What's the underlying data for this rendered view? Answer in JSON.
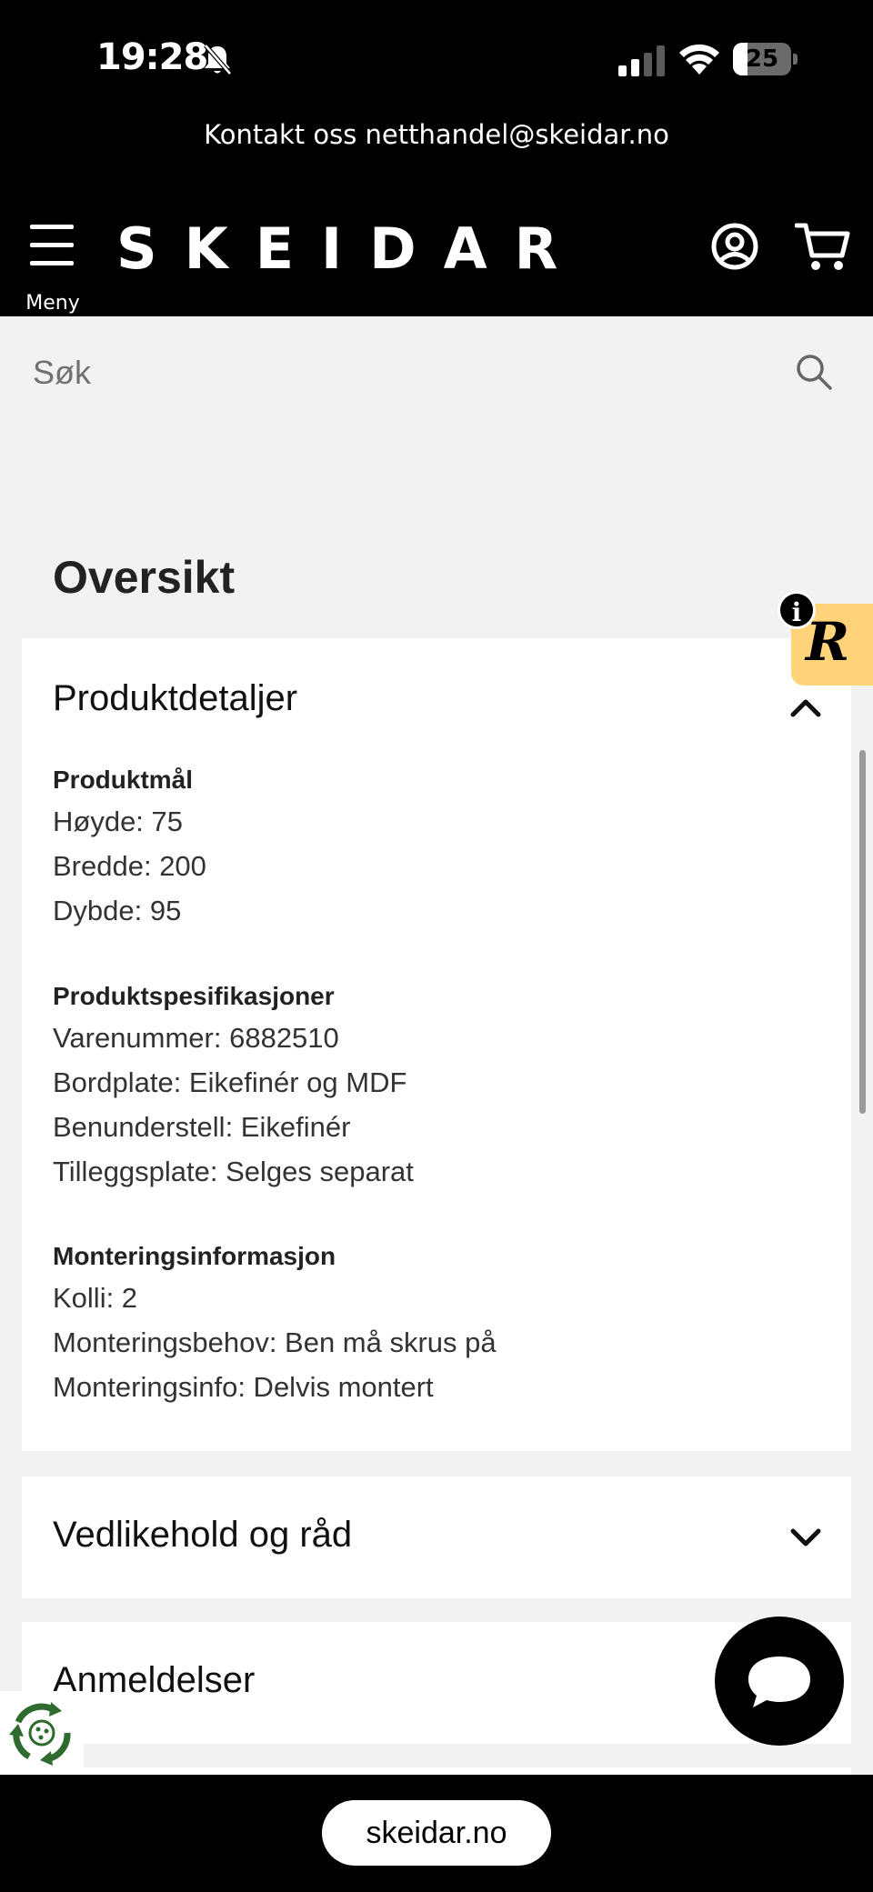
{
  "status_bar": {
    "time": "19:28",
    "battery": "25",
    "battery_level_percent": 25,
    "icons": [
      "bell-slash-icon",
      "signal-icon",
      "wifi-icon",
      "battery-icon"
    ]
  },
  "banner": {
    "contact_text": "Kontakt oss netthandel@skeidar.no"
  },
  "header": {
    "menu_label": "Meny",
    "logo": "SKEIDAR",
    "icons": [
      "menu-icon",
      "account-icon",
      "cart-icon"
    ]
  },
  "search": {
    "placeholder": "Søk"
  },
  "overview": {
    "heading": "Oversikt"
  },
  "product_details": {
    "title": "Produktdetaljer",
    "expanded": true,
    "groups": [
      {
        "heading": "Produktmål",
        "lines": [
          "Høyde: 75",
          "Bredde: 200",
          "Dybde: 95"
        ]
      },
      {
        "heading": "Produktspesifikasjoner",
        "lines": [
          "Varenummer: 6882510",
          "Bordplate: Eikefinér og MDF",
          "Benunderstell: Eikefinér",
          "Tilleggsplate: Selges separat"
        ]
      },
      {
        "heading": "Monteringsinformasjon",
        "lines": [
          "Kolli: 2",
          "Monteringsbehov: Ben må skrus på",
          "Monteringsinfo: Delvis montert"
        ]
      }
    ]
  },
  "maintenance": {
    "title": "Vedlikehold og råd",
    "expanded": false
  },
  "reviews": {
    "title": "Anmeldelser"
  },
  "widgets": {
    "info": "i",
    "r_badge": "R"
  },
  "browser": {
    "url": "skeidar.no"
  },
  "colors": {
    "header_bg": "#000000",
    "page_bg": "#f2f2f2",
    "card_bg": "#ffffff",
    "r_badge_bg": "#ffd37a"
  }
}
